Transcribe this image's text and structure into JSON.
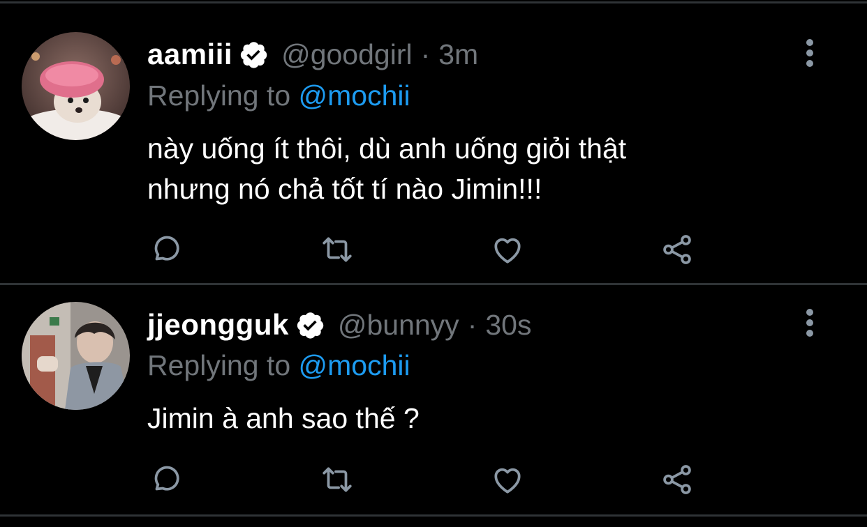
{
  "tweets": [
    {
      "display_name": "aamiii",
      "handle": "@goodgirl",
      "separator": "·",
      "time": "3m",
      "replying_prefix": "Replying to",
      "replying_to": "@mochii",
      "text_lines": [
        "này uống ít thôi, dù anh uống giỏi thật",
        "nhưng nó chả tốt tí nào Jimin!!!"
      ],
      "verified": true,
      "avatar_icon": "dog-with-shower-cap-avatar"
    },
    {
      "display_name": "jjeongguk",
      "handle": "@bunnyy",
      "separator": "·",
      "time": "30s",
      "replying_prefix": "Replying to",
      "replying_to": "@mochii",
      "text_lines": [
        "Jimin à anh sao thế ?"
      ],
      "verified": true,
      "avatar_icon": "person-denim-jacket-avatar"
    }
  ],
  "actions": [
    "reply-icon",
    "retweet-icon",
    "like-icon",
    "share-icon"
  ],
  "colors": {
    "background": "#000000",
    "divider": "#2f3336",
    "muted": "#71767b",
    "mention": "#1d9bf0",
    "icon": "#8b98a5"
  }
}
